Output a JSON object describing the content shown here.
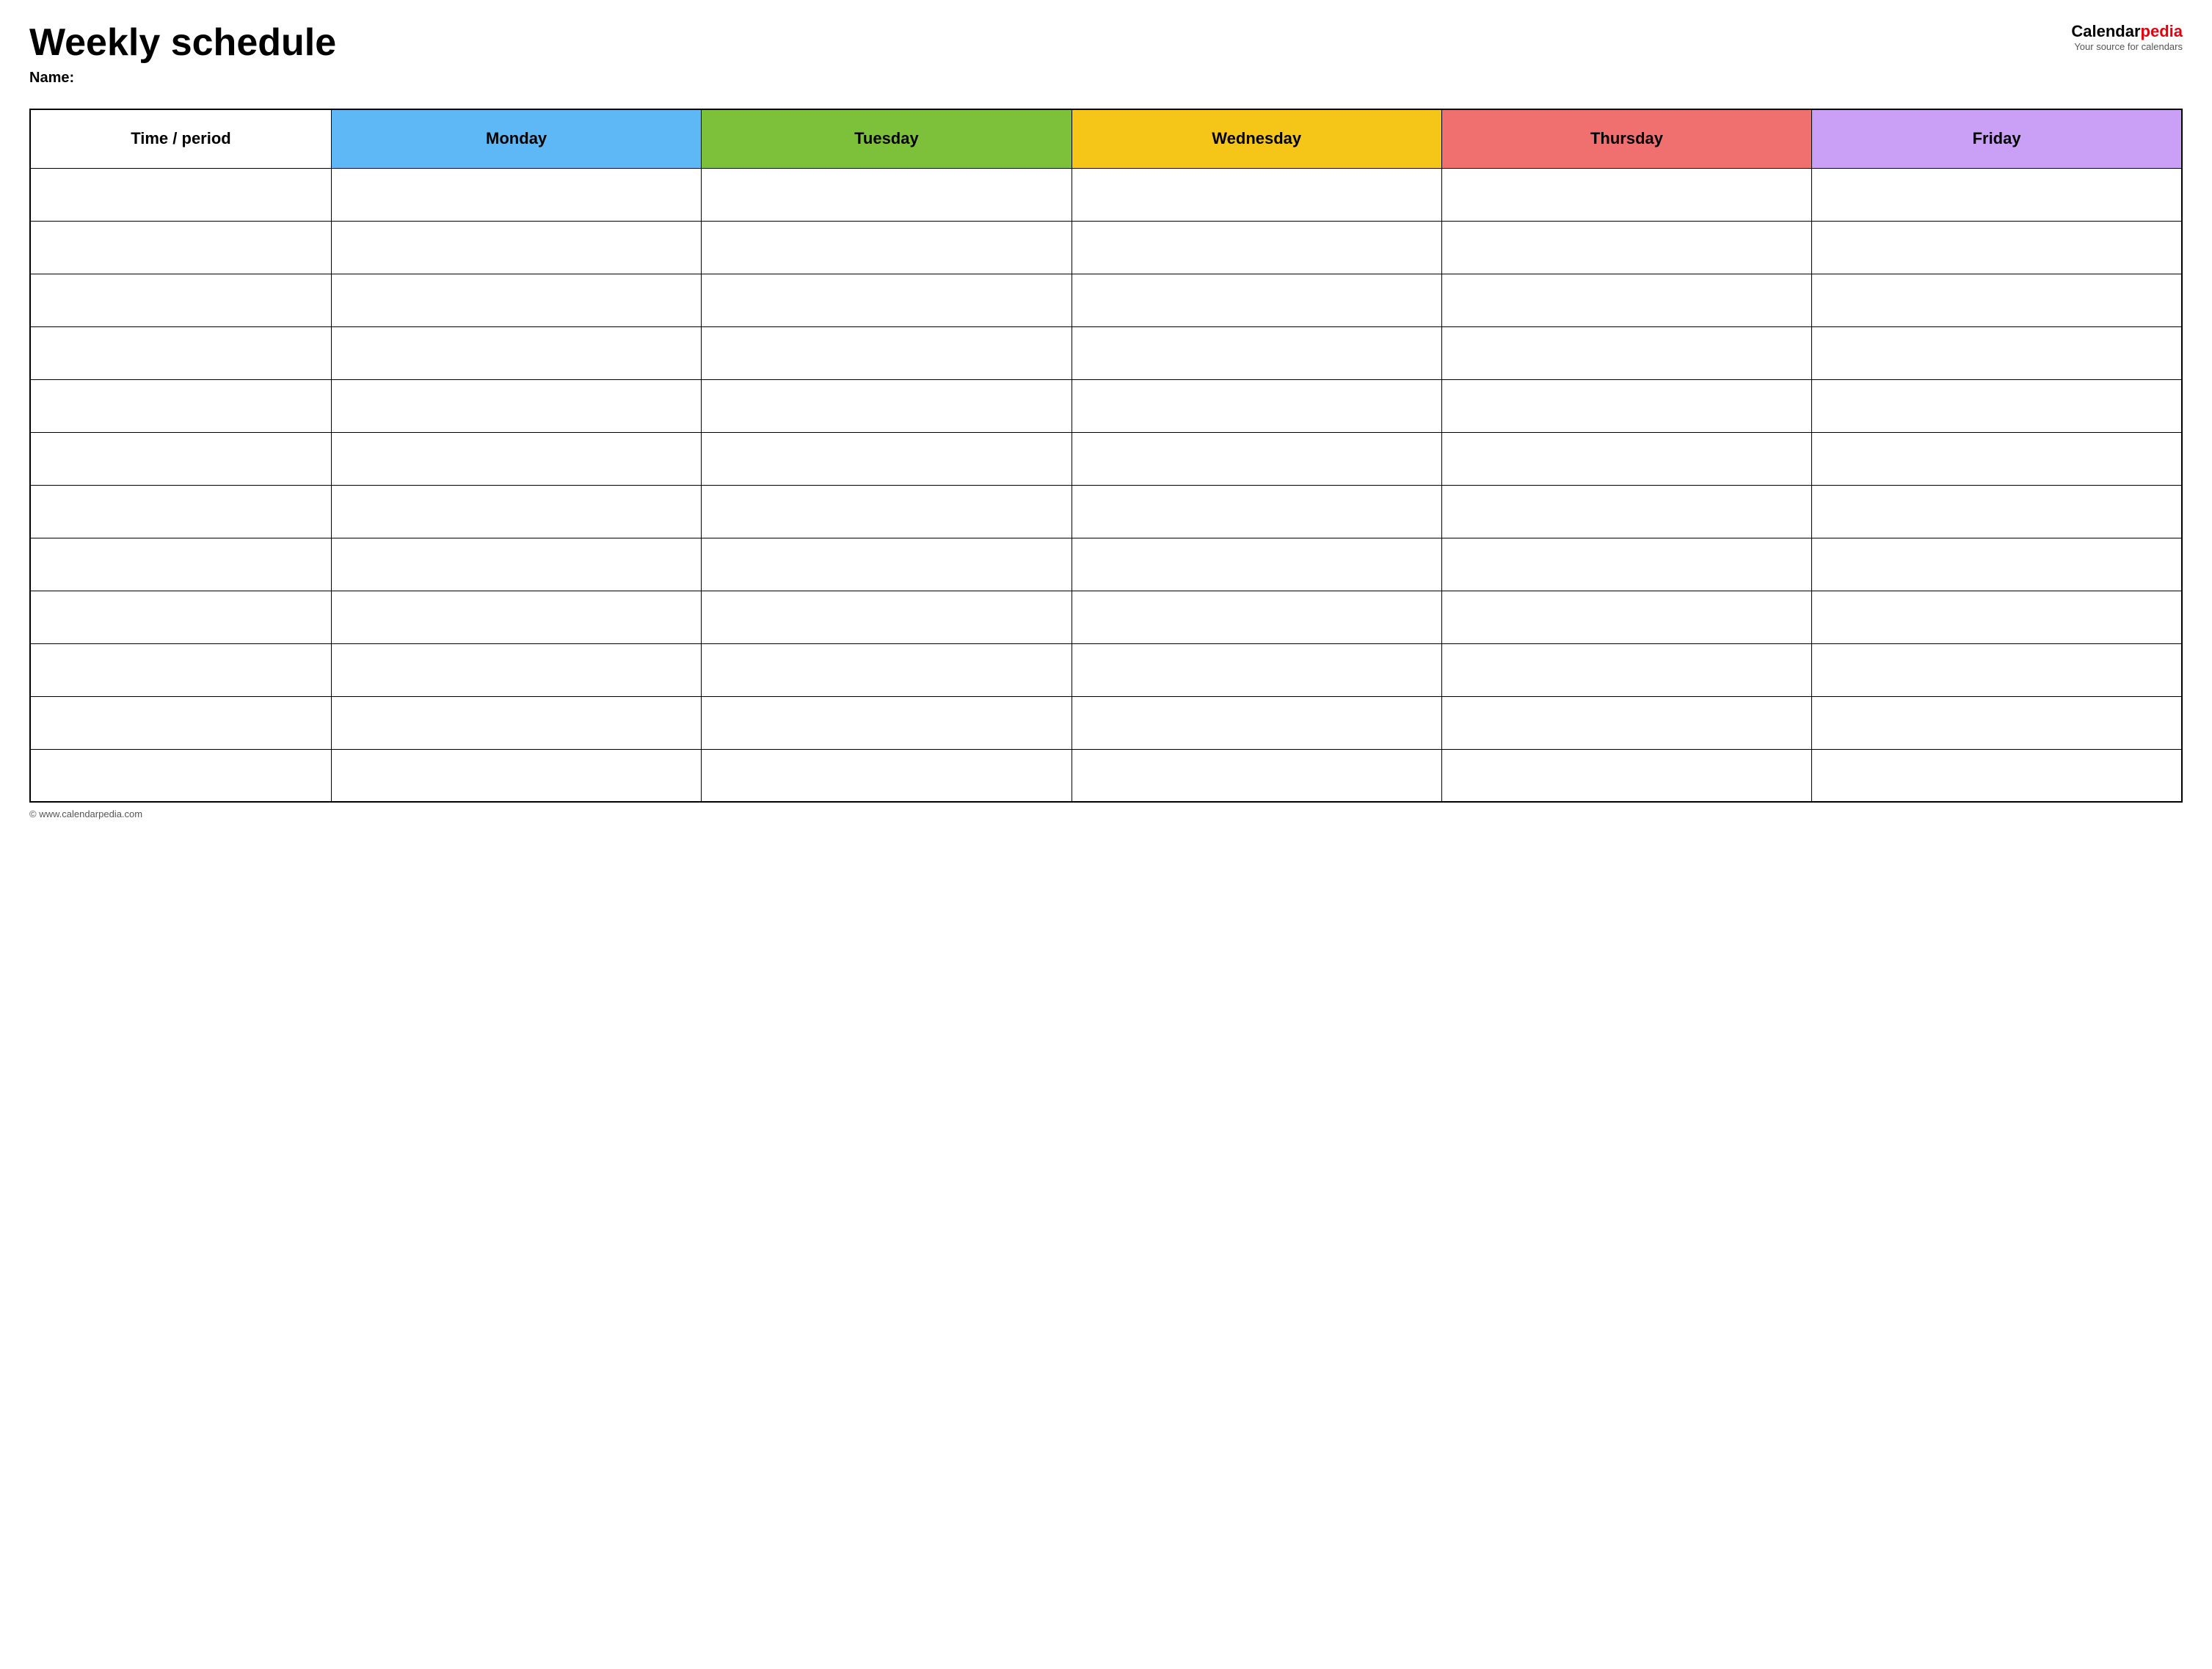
{
  "header": {
    "title": "Weekly schedule",
    "name_label": "Name:",
    "logo_calendar": "Calendar",
    "logo_pedia": "pedia",
    "logo_tagline": "Your source for calendars"
  },
  "table": {
    "columns": [
      {
        "key": "time",
        "label": "Time / period",
        "class": "th-time"
      },
      {
        "key": "monday",
        "label": "Monday",
        "class": "th-monday"
      },
      {
        "key": "tuesday",
        "label": "Tuesday",
        "class": "th-tuesday"
      },
      {
        "key": "wednesday",
        "label": "Wednesday",
        "class": "th-wednesday"
      },
      {
        "key": "thursday",
        "label": "Thursday",
        "class": "th-thursday"
      },
      {
        "key": "friday",
        "label": "Friday",
        "class": "th-friday"
      }
    ],
    "row_count": 12
  },
  "footer": {
    "text": "© www.calendarpedia.com"
  }
}
